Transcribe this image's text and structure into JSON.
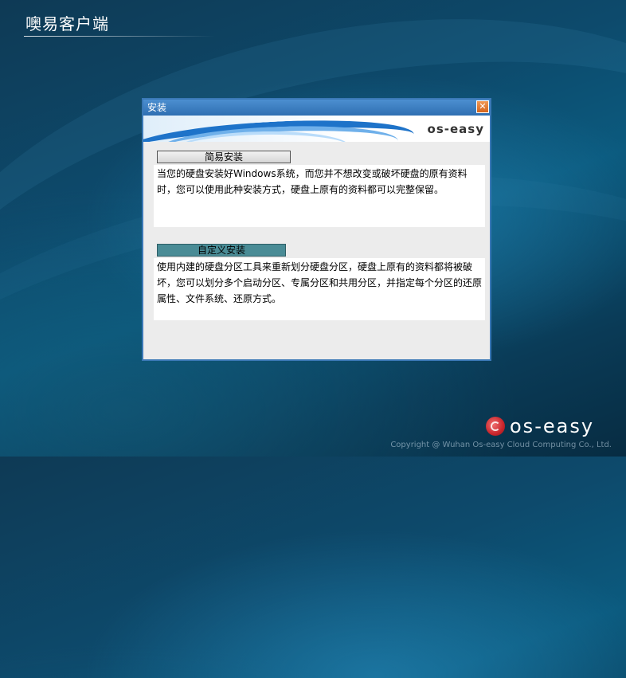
{
  "app": {
    "title": "噢易客户端"
  },
  "dialog": {
    "title": "安装",
    "close_label": "✕",
    "banner_logo": "os-easy",
    "options": [
      {
        "label": "简易安装",
        "description": "当您的硬盘安装好Windows系统，而您并不想改变或破坏硬盘的原有资料时，您可以使用此种安装方式，硬盘上原有的资料都可以完整保留。",
        "selected": false
      },
      {
        "label": "自定义安装",
        "description": "使用内建的硬盘分区工具来重新划分硬盘分区，硬盘上原有的资料都将被破坏，您可以划分多个启动分区、专属分区和共用分区，并指定每个分区的还原属性、文件系统、还原方式。",
        "selected": true
      }
    ]
  },
  "footer": {
    "logo_text": "os-easy",
    "copyright": "Copyright @ Wuhan Os-easy Cloud Computing Co., Ltd."
  },
  "colors": {
    "titlebar": "#2f6fb2",
    "active_button": "#4a8c96",
    "brand_red": "#c9252c"
  },
  "icons": {
    "close": "close-icon",
    "logo": "os-easy-logo-icon"
  }
}
